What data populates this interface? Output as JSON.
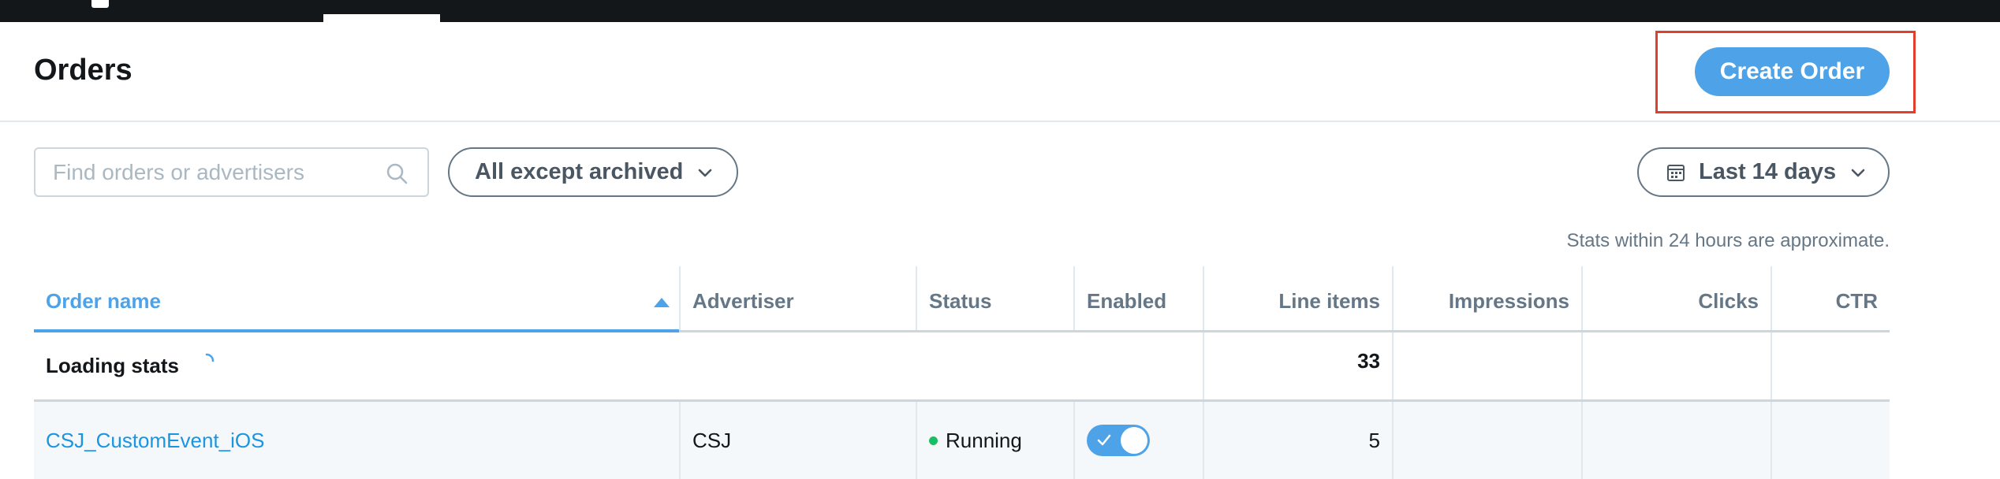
{
  "page": {
    "title": "Orders"
  },
  "header": {
    "create_button": "Create Order"
  },
  "filters": {
    "search_placeholder": "Find orders or advertisers",
    "status_filter": "All except archived",
    "date_range": "Last 14 days"
  },
  "stats_note": "Stats within 24 hours are approximate.",
  "table": {
    "columns": {
      "order_name": "Order name",
      "advertiser": "Advertiser",
      "status": "Status",
      "enabled": "Enabled",
      "line_items": "Line items",
      "impressions": "Impressions",
      "clicks": "Clicks",
      "ctr": "CTR"
    },
    "sorted_column": "Order name",
    "summary": {
      "label": "Loading stats",
      "line_items": "33"
    },
    "rows": [
      {
        "order_name": "CSJ_CustomEvent_iOS",
        "advertiser": "CSJ",
        "status": "Running",
        "enabled": true,
        "line_items": "5",
        "impressions": "",
        "clicks": "",
        "ctr": ""
      }
    ]
  },
  "colors": {
    "accent": "#4ea3e8",
    "link": "#1b95e0",
    "running_status": "#17bf63",
    "highlight_box": "#e0402b",
    "top_bar": "#14171a"
  },
  "icons": {
    "search": "search-icon",
    "filter_chevron": "chevron-down-icon",
    "calendar": "calendar-icon",
    "date_chevron": "chevron-down-icon",
    "sort": "sort-ascending-icon",
    "spinner": "loading-spinner-icon",
    "toggle_check": "check-icon"
  }
}
